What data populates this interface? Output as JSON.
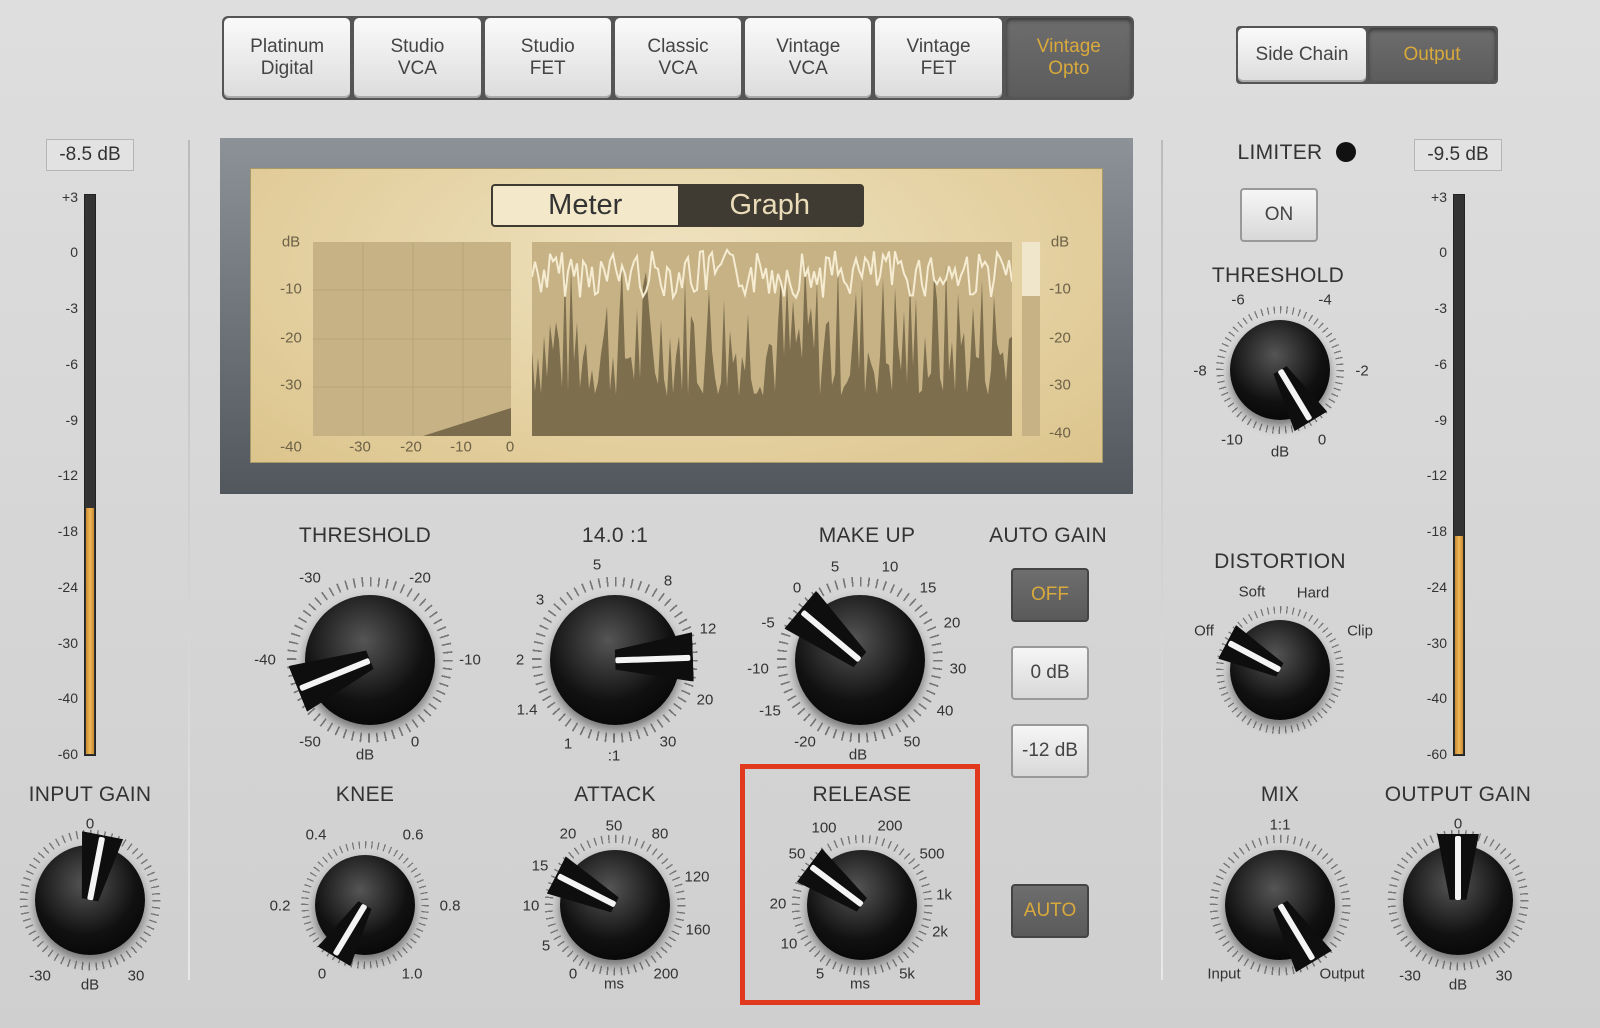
{
  "models": {
    "items": [
      "Platinum\nDigital",
      "Studio\nVCA",
      "Studio\nFET",
      "Classic\nVCA",
      "Vintage\nVCA",
      "Vintage\nFET",
      "Vintage\nOpto"
    ],
    "active": 6
  },
  "view_tabs": {
    "items": [
      "Side Chain",
      "Output"
    ],
    "active": 1
  },
  "input_meter": {
    "readout": "-8.5 dB",
    "level_fraction": 0.44
  },
  "output_meter": {
    "readout": "-9.5 dB",
    "level_fraction": 0.39
  },
  "meter_scale": [
    "+3",
    "0",
    "-3",
    "-6",
    "-9",
    "-12",
    "-18",
    "-24",
    "-30",
    "-40",
    "-60"
  ],
  "display": {
    "toggle": [
      "Meter",
      "Graph"
    ],
    "active": "Graph",
    "y_labels": [
      "dB",
      "-10",
      "-20",
      "-30",
      "-40"
    ],
    "x_labels": [
      "-30",
      "-20",
      "-10",
      "0"
    ],
    "right_labels": [
      "dB",
      "-10",
      "-20",
      "-30",
      "-40"
    ]
  },
  "knobs": {
    "threshold": {
      "title": "THRESHOLD",
      "scale": [
        "-30",
        "-20",
        "-40",
        "-10",
        "-50",
        "0",
        "dB"
      ]
    },
    "ratio": {
      "title": "14.0 :1",
      "scale": [
        "5",
        "8",
        "3",
        "12",
        "2",
        "20",
        "1.4",
        "30",
        "1",
        ":1"
      ]
    },
    "makeup": {
      "title": "MAKE UP",
      "scale": [
        "5",
        "10",
        "0",
        "15",
        "-5",
        "20",
        "-10",
        "30",
        "-15",
        "40",
        "-20",
        "50",
        "dB"
      ]
    },
    "input_gain": {
      "title": "INPUT GAIN",
      "scale": [
        "0",
        "-30",
        "dB",
        "30"
      ]
    },
    "knee": {
      "title": "KNEE",
      "scale": [
        "0.4",
        "0.6",
        "0.2",
        "0.8",
        "0",
        "1.0"
      ]
    },
    "attack": {
      "title": "ATTACK",
      "scale": [
        "20",
        "50",
        "80",
        "15",
        "120",
        "10",
        "160",
        "5",
        "0",
        "ms",
        "200"
      ]
    },
    "release": {
      "title": "RELEASE",
      "scale": [
        "100",
        "200",
        "50",
        "500",
        "20",
        "1k",
        "10",
        "2k",
        "5",
        "ms",
        "5k"
      ]
    },
    "limiter_threshold": {
      "title": "THRESHOLD",
      "scale": [
        "-6",
        "-4",
        "-8",
        "-2",
        "-10",
        "dB",
        "0"
      ]
    },
    "distortion": {
      "title": "DISTORTION",
      "scale": [
        "Soft",
        "Hard",
        "Off",
        "Clip"
      ]
    },
    "mix": {
      "title": "MIX",
      "scale": [
        "1:1",
        "Input",
        "Output"
      ]
    },
    "output_gain": {
      "title": "OUTPUT GAIN",
      "scale": [
        "0",
        "-30",
        "dB",
        "30"
      ]
    }
  },
  "auto_gain": {
    "title": "AUTO GAIN",
    "buttons": [
      "OFF",
      "0 dB",
      "-12 dB"
    ],
    "active": "OFF"
  },
  "auto_release": {
    "label": "AUTO",
    "active": true
  },
  "limiter": {
    "label": "LIMITER",
    "button": "ON"
  },
  "colors": {
    "accent": "#d9a93c",
    "highlight": "#e0391d",
    "meter": "#f0b85a"
  }
}
